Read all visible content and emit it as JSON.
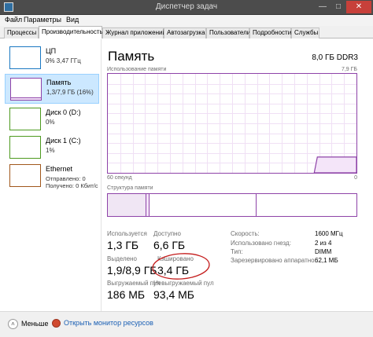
{
  "window": {
    "title": "Диспетчер задач"
  },
  "menu": [
    "Файл",
    "Параметры",
    "Вид"
  ],
  "tabs": [
    "Процессы",
    "Производительность",
    "Журнал приложений",
    "Автозагрузка",
    "Пользователи",
    "Подробности",
    "Службы"
  ],
  "sidebar": {
    "items": [
      {
        "name": "ЦП",
        "value": "0% 3,47 ГГц",
        "color": "#1a78c2"
      },
      {
        "name": "Память",
        "value": "1,3/7,9 ГБ (16%)",
        "color": "#8e43a8"
      },
      {
        "name": "Диск 0 (D:)",
        "value": "0%",
        "color": "#4d9a1f"
      },
      {
        "name": "Диск 1 (C:)",
        "value": "1%",
        "color": "#4d9a1f"
      },
      {
        "name": "Ethernet",
        "value": "Отправлено: 0 Получено: 0 Кбит/с",
        "color": "#a0571b"
      }
    ]
  },
  "memory": {
    "title": "Память",
    "total": "8,0 ГБ DDR3",
    "graph_label": "Использование памяти",
    "graph_max": "7,9 ГБ",
    "time_label": "60 секунд",
    "graph_min": "0",
    "structure_label": "Структура памяти",
    "usage_fraction": 0.16,
    "stats": {
      "in_use_label": "Используется",
      "in_use": "1,3 ГБ",
      "available_label": "Доступно",
      "available": "6,6 ГБ",
      "committed_label": "Выделено",
      "committed": "1,9/8,9 ГБ",
      "cached_label": "Кэшировано",
      "cached": "3,4 ГБ",
      "paged_label": "Выгружаемый пул",
      "paged": "186 МБ",
      "nonpaged_label": "Невыгружаемый пул",
      "nonpaged": "93,4 МБ"
    },
    "props": {
      "speed_label": "Скорость:",
      "speed": "1600 МГц",
      "slots_label": "Использовано гнезд:",
      "slots": "2 из 4",
      "form_label": "Тип:",
      "form": "DIMM",
      "reserved_label": "Зарезервировано аппаратно:",
      "reserved": "62,1 МБ"
    }
  },
  "footer": {
    "less": "Меньше",
    "monitor": "Открыть монитор ресурсов"
  }
}
